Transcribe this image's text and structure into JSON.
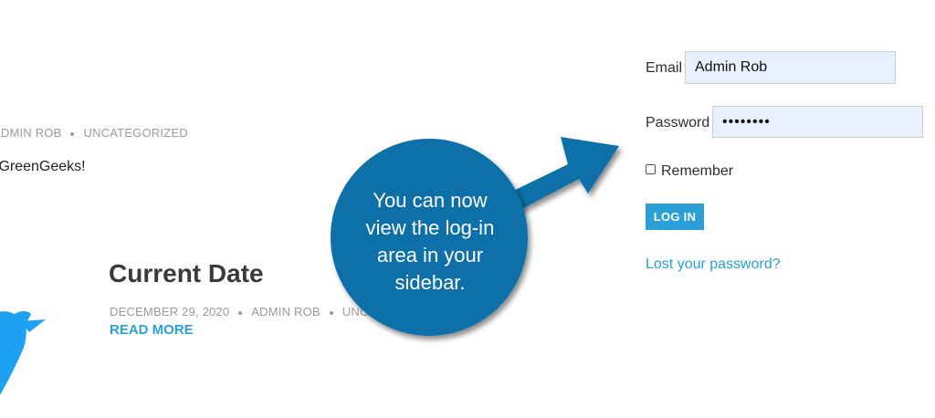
{
  "posts": [
    {
      "author": "ADMIN ROB",
      "category": "UNCATEGORIZED",
      "excerpt": "y GreenGeeks!"
    },
    {
      "title": "Current Date",
      "date": "DECEMBER 29, 2020",
      "author": "ADMIN ROB",
      "category": "UNCAT",
      "read_more": "READ MORE"
    }
  ],
  "login": {
    "email_label": "Email",
    "email_value": "Admin Rob",
    "password_label": "Password",
    "password_value": "********",
    "remember_label": "Remember",
    "remember_checked": false,
    "login_button": "LOG IN",
    "lost_password": "Lost your password?"
  },
  "callout": {
    "lines": [
      "You can now",
      "view the log-in",
      "area in your",
      "sidebar."
    ]
  },
  "icons": {
    "twitter": "twitter-bird-icon",
    "callout_arrow": "arrow-icon"
  },
  "colors": {
    "accent": "#2a9fd8",
    "callout": "#0f6fa8",
    "twitter": "#1da1f2",
    "field_bg": "#e8f0fe"
  }
}
